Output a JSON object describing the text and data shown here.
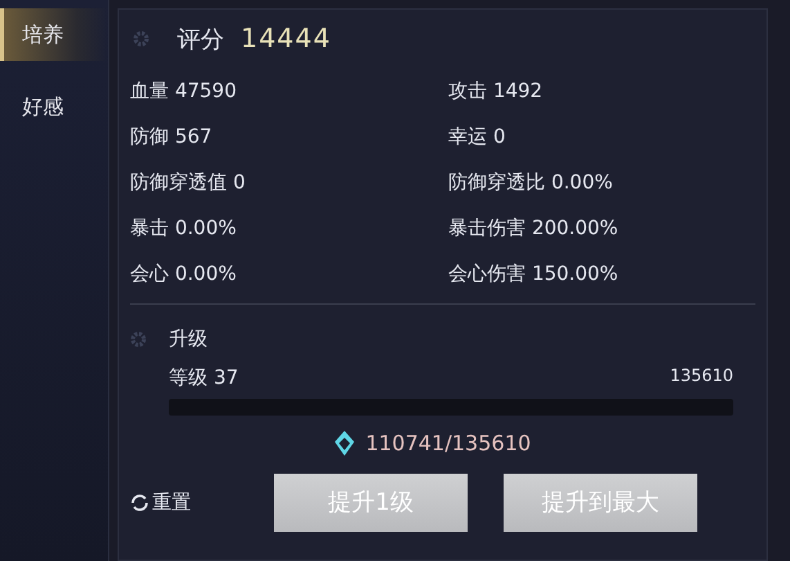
{
  "sidebar": {
    "tabs": [
      {
        "label": "培养",
        "selected": true
      },
      {
        "label": "好感",
        "selected": false
      }
    ]
  },
  "score": {
    "label": "评分",
    "value": "14444"
  },
  "stats": [
    {
      "text": "血量 47590"
    },
    {
      "text": "攻击 1492"
    },
    {
      "text": "防御 567"
    },
    {
      "text": "幸运 0"
    },
    {
      "text": "防御穿透值 0"
    },
    {
      "text": "防御穿透比 0.00%"
    },
    {
      "text": "暴击 0.00%"
    },
    {
      "text": "暴击伤害 200.00%"
    },
    {
      "text": "会心 0.00%"
    },
    {
      "text": "会心伤害 150.00%"
    }
  ],
  "upgrade": {
    "title": "升级",
    "level_label": "等级 37",
    "max_exp": "135610",
    "level": 0,
    "cost": "110741/135610"
  },
  "reset": {
    "label": "重置"
  },
  "buttons": [
    {
      "label": "提升1级"
    },
    {
      "label": "提升到最大"
    }
  ]
}
